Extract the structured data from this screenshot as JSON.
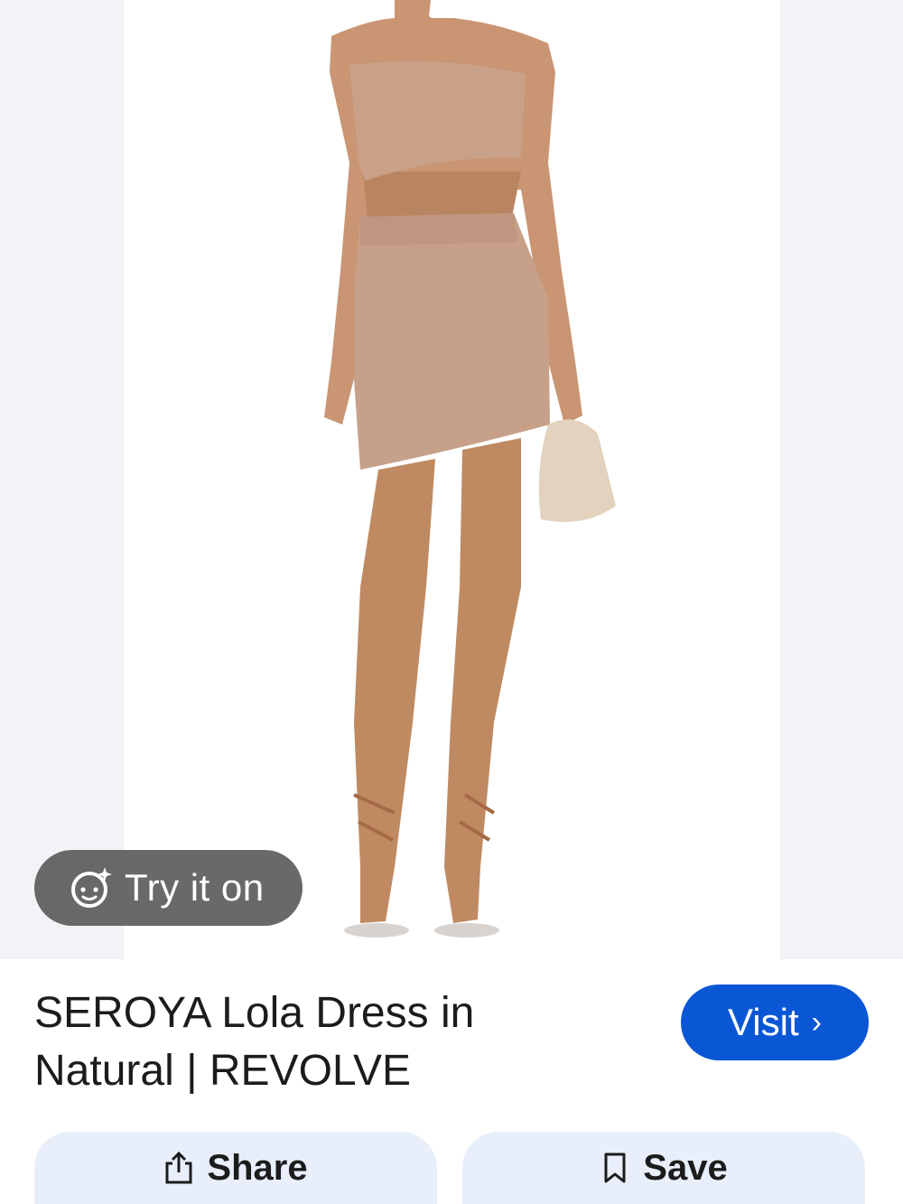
{
  "result": {
    "try_on_label": "Try it on",
    "title": "SEROYA Lola Dress in Natural | REVOLVE",
    "visit_label": "Visit"
  },
  "actions": {
    "share_label": "Share",
    "save_label": "Save"
  },
  "colors": {
    "accent": "#0a57d6",
    "action_bg": "#e8effb",
    "pill_bg": "#5c5c5c"
  },
  "icons": {
    "try_on": "face-sparkle-icon",
    "visit": "chevron-right-icon",
    "share": "share-icon",
    "save": "bookmark-icon"
  }
}
